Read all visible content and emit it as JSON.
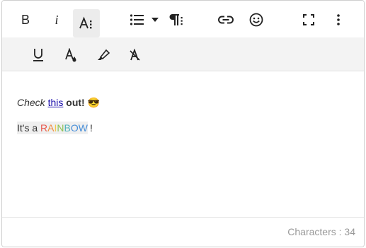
{
  "toolbar": {
    "bold_label": "B",
    "italic_label": "i",
    "row1_icons": [
      "bold-icon",
      "italic-icon",
      "font-size-icon",
      "bulleted-list-icon",
      "chevron-down-icon",
      "paragraph-format-icon",
      "link-icon",
      "emoticon-icon",
      "fullscreen-icon",
      "more-icon"
    ],
    "row2_icons": [
      "underline-icon",
      "text-color-icon",
      "highlighter-icon",
      "clear-formatting-icon"
    ]
  },
  "content": {
    "line1": {
      "word1": "Check",
      "word2": "this",
      "word3": "out!",
      "emoji": "😎"
    },
    "line2": {
      "prefix": "It's a ",
      "rainbow": [
        "R",
        "A",
        "I",
        "N",
        "B",
        "O",
        "W"
      ],
      "suffix": "!"
    }
  },
  "footer": {
    "characters_label": "Characters : 34"
  },
  "colors": {
    "rainbow": [
      "#e85a4f",
      "#f08a3c",
      "#f2c84b",
      "#8cc152",
      "#4fb3b8",
      "#4a90d9",
      "#4a90d9"
    ],
    "link": "#1a0dab",
    "toolbar_row2_bg": "#f3f3f3"
  }
}
